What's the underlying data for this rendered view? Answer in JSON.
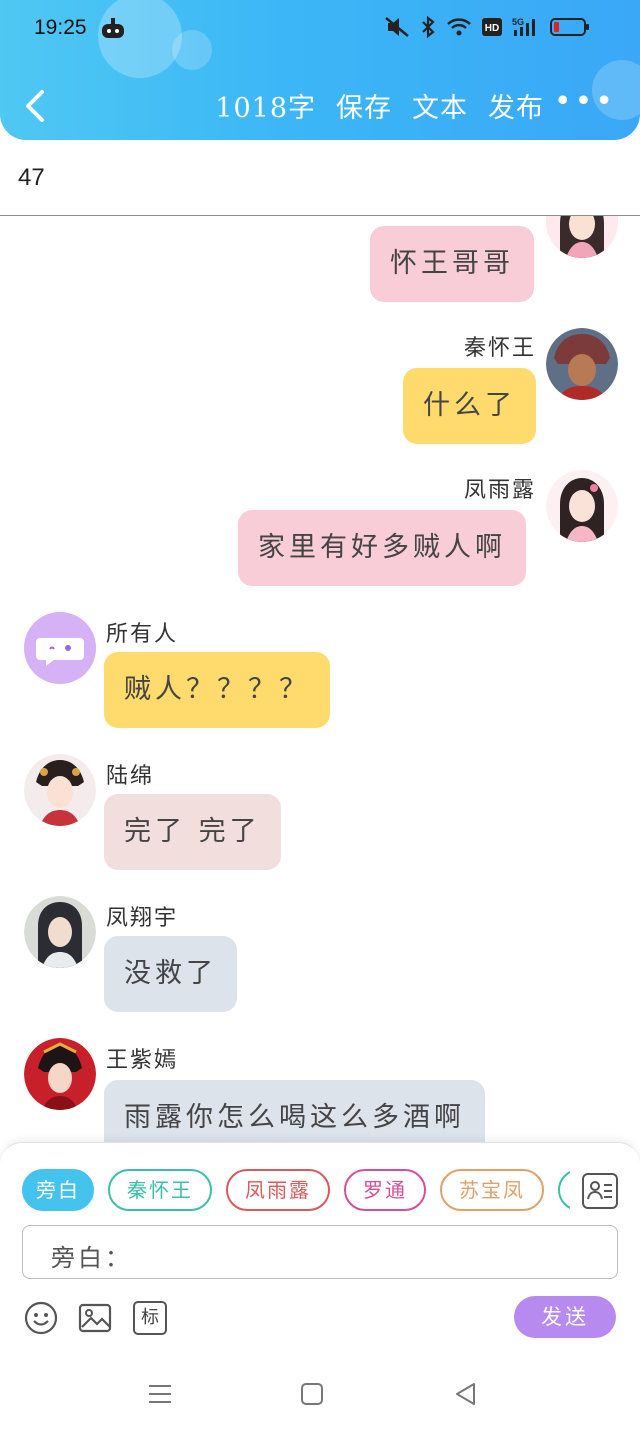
{
  "status_bar": {
    "time": "19:25"
  },
  "header": {
    "back_icon": "chevron-left-icon",
    "actions": [
      "1018字",
      "保存",
      "文本",
      "发布"
    ],
    "more_icon": "more-dots-icon"
  },
  "number_row": {
    "value": "47"
  },
  "messages": [
    {
      "side": "right",
      "name": "",
      "text": "怀王哥哥",
      "bubble_color": "#f8cdd8",
      "avatar": "female-avatar-icon"
    },
    {
      "side": "right",
      "name": "秦怀王",
      "text": "什么了",
      "bubble_color": "#ffdb6e",
      "avatar": "male-avatar-icon"
    },
    {
      "side": "right",
      "name": "凤雨露",
      "text": "家里有好多贼人啊",
      "bubble_color": "#f8cdd8",
      "avatar": "female-avatar-icon"
    },
    {
      "side": "left",
      "name": "所有人",
      "text": "贼人？？？？",
      "bubble_color": "#ffdb6e",
      "avatar": "group-chat-icon"
    },
    {
      "side": "left",
      "name": "陆绵",
      "text": "完了 完了",
      "bubble_color": "#f3dede",
      "avatar": "female-avatar-icon"
    },
    {
      "side": "left",
      "name": "凤翔宇",
      "text": "没救了",
      "bubble_color": "#dde3ea",
      "avatar": "male-avatar-icon"
    },
    {
      "side": "left",
      "name": "王紫嫣",
      "text": "雨露你怎么喝这么多酒啊",
      "bubble_color": "#dde3ea",
      "avatar": "female-avatar-icon"
    }
  ],
  "character_chips": [
    {
      "label": "旁白",
      "color": "#44c3ee",
      "filled": true
    },
    {
      "label": "秦怀王",
      "color": "#3bbfa9",
      "filled": false
    },
    {
      "label": "凤雨露",
      "color": "#d85a5a",
      "filled": false
    },
    {
      "label": "罗通",
      "color": "#d84d99",
      "filled": false
    },
    {
      "label": "苏宝凤",
      "color": "#e0a068",
      "filled": false
    },
    {
      "label": "",
      "color": "#3bbfa9",
      "filled": false
    }
  ],
  "input": {
    "prefix": "旁白："
  },
  "toolbar": {
    "tag_label": "标",
    "send_label": "发送"
  }
}
